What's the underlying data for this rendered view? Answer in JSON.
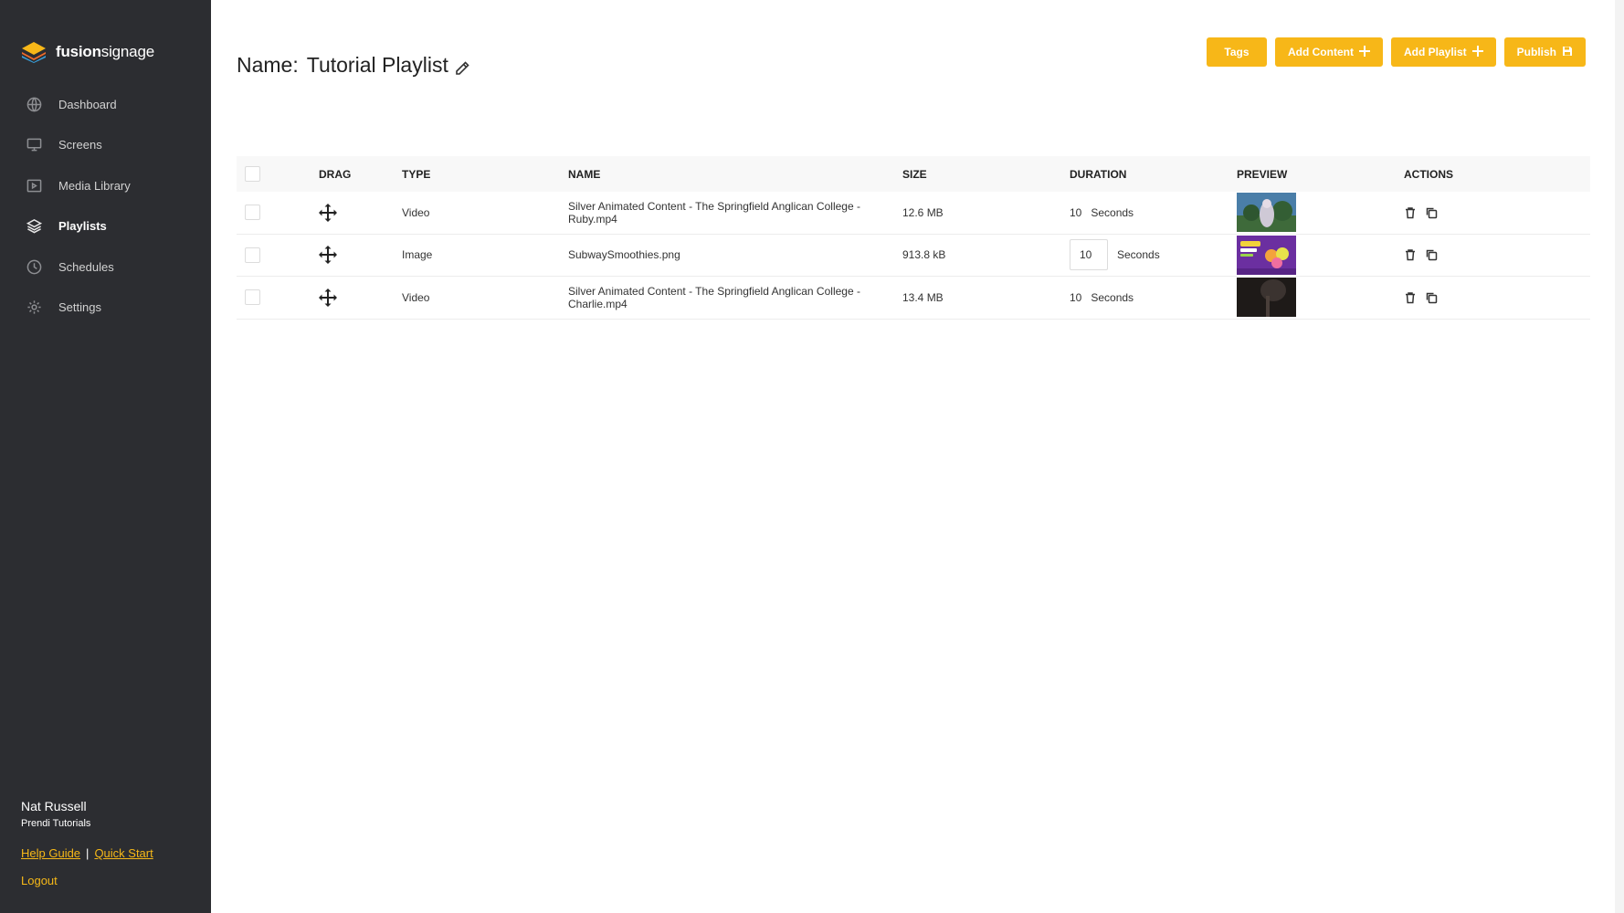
{
  "brand": {
    "name_bold": "fusion",
    "name_rest": "signage"
  },
  "nav": [
    {
      "label": "Dashboard",
      "icon": "dashboard-icon",
      "active": false
    },
    {
      "label": "Screens",
      "icon": "screen-icon",
      "active": false
    },
    {
      "label": "Media Library",
      "icon": "media-icon",
      "active": false
    },
    {
      "label": "Playlists",
      "icon": "layers-icon",
      "active": true
    },
    {
      "label": "Schedules",
      "icon": "clock-icon",
      "active": false
    },
    {
      "label": "Settings",
      "icon": "gear-icon",
      "active": false
    }
  ],
  "user": {
    "name": "Nat Russell",
    "org": "Prendi Tutorials",
    "help_link": "Help Guide",
    "separator": "|",
    "quick_start_link": "Quick Start",
    "logout": "Logout"
  },
  "page": {
    "title_label": "Name:",
    "title_value": "Tutorial Playlist"
  },
  "toolbar": {
    "tags": "Tags",
    "add_content": "Add Content",
    "add_playlist": "Add Playlist",
    "publish": "Publish"
  },
  "table": {
    "headers": {
      "drag": "DRAG",
      "type": "TYPE",
      "name": "NAME",
      "size": "SIZE",
      "duration": "DURATION",
      "preview": "PREVIEW",
      "actions": "ACTIONS"
    },
    "rows": [
      {
        "type": "Video",
        "name": "Silver Animated Content - The Springfield Anglican College - Ruby.mp4",
        "size": "12.6 MB",
        "duration": "10",
        "unit": "Seconds"
      },
      {
        "type": "Image",
        "name": "SubwaySmoothies.png",
        "size": "913.8 kB",
        "duration": "10",
        "unit": "Seconds"
      },
      {
        "type": "Video",
        "name": "Silver Animated Content - The Springfield Anglican College - Charlie.mp4",
        "size": "13.4 MB",
        "duration": "10",
        "unit": "Seconds"
      }
    ]
  },
  "colors": {
    "accent": "#f7b718",
    "sidebar_bg": "#2c2d31"
  }
}
